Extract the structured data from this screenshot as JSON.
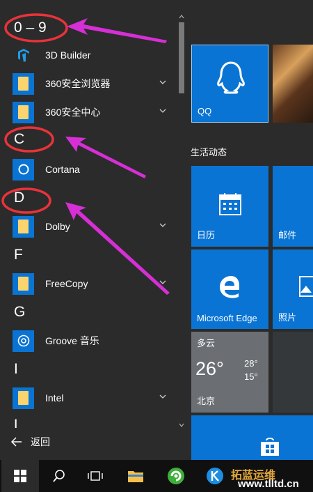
{
  "app_list": {
    "headers": {
      "h09": "0 – 9",
      "hC": "C",
      "hD": "D",
      "hF": "F",
      "hG": "G",
      "hI": "I",
      "hL": "L"
    },
    "items": [
      {
        "label": "3D Builder",
        "icon": "3d-builder-icon"
      },
      {
        "label": "360安全浏览器",
        "icon": "folder-icon"
      },
      {
        "label": "360安全中心",
        "icon": "folder-icon"
      },
      {
        "label": "Cortana",
        "icon": "cortana-icon"
      },
      {
        "label": "Dolby",
        "icon": "folder-icon"
      },
      {
        "label": "FreeCopy",
        "icon": "folder-icon"
      },
      {
        "label": "Groove 音乐",
        "icon": "groove-icon"
      },
      {
        "label": "Intel",
        "icon": "folder-icon"
      }
    ],
    "back_label": "返回"
  },
  "tiles": {
    "qq_label": "QQ",
    "section_title": "生活动态",
    "calendar_label": "日历",
    "mail_label": "邮件",
    "edge_label": "Microsoft Edge",
    "photos_label": "照片",
    "weather": {
      "condition": "多云",
      "temp": "26°",
      "high": "28°",
      "low": "15°",
      "city": "北京"
    }
  },
  "taskbar": {
    "icons": [
      "windows-start-icon",
      "search-icon",
      "task-view-icon",
      "file-explorer-icon",
      "browser-360-icon",
      "kugou-icon"
    ]
  },
  "watermark": {
    "text": "拓蓝运维",
    "url": "www.tlltd.cn"
  },
  "colors": {
    "accent": "#0a74d4",
    "annotation_circle": "#e8333a",
    "annotation_arrow": "#d62fd6"
  }
}
